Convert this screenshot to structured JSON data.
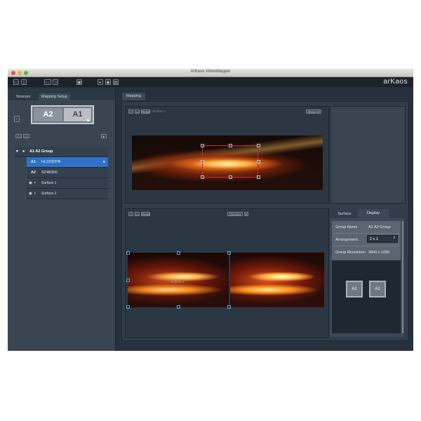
{
  "window": {
    "title": "ArKaos VideoMapper",
    "brand": "arKaos"
  },
  "left_panel": {
    "tabs": [
      "Sources",
      "Mapping Setup"
    ],
    "preview_labels": [
      "A2",
      "A1"
    ],
    "group": {
      "name": "A1 A2 Group",
      "items": [
        {
          "id": "A1",
          "label": "HL229DPB"
        },
        {
          "id": "A2",
          "label": "S24B300"
        }
      ],
      "surfaces": [
        "Surface 1",
        "Surface 2"
      ]
    }
  },
  "mapping": {
    "tab": "Mapping",
    "top": {
      "reset_label": "Reset",
      "surface_label": "Surface 1",
      "show_all_label": "Show All"
    },
    "bottom": {
      "reset_label": "Reset",
      "checker_label": "Checker",
      "surface_overlay_label": "Surface 1"
    }
  },
  "properties": {
    "tabs": [
      "Surface",
      "Display"
    ],
    "group_name_label": "Group Name",
    "group_name_value": "A1 A2 Group",
    "arrangement_label": "Arrangement",
    "arrangement_value": "2 x 1",
    "resolution_label": "Group Resolution",
    "resolution_value": "3840 x 1080",
    "display_labels": [
      "A2",
      "A1"
    ]
  }
}
